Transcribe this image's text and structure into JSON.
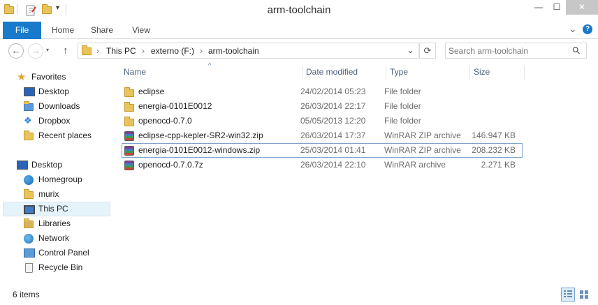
{
  "window": {
    "title": "arm-toolchain",
    "minimize_glyph": "—",
    "maximize_glyph": "☐",
    "close_glyph": "✕"
  },
  "ribbon": {
    "tabs": [
      {
        "label": "File"
      },
      {
        "label": "Home"
      },
      {
        "label": "Share"
      },
      {
        "label": "View"
      }
    ],
    "expand_glyph": "⌄",
    "help_glyph": "?"
  },
  "address": {
    "back_glyph": "←",
    "forward_glyph": "→",
    "up_glyph": "↑",
    "breadcrumbs": [
      "This PC",
      "externo (F:)",
      "arm-toolchain"
    ],
    "separator": "›",
    "dropdown_glyph": "⌄",
    "refresh_glyph": "⟳",
    "search_placeholder": "Search arm-toolchain",
    "search_glyph": "⚲"
  },
  "nav": {
    "favorites_label": "Favorites",
    "favorites": [
      {
        "label": "Desktop",
        "icon": "desktop-icon"
      },
      {
        "label": "Downloads",
        "icon": "downloads-icon"
      },
      {
        "label": "Dropbox",
        "icon": "dropbox-icon"
      },
      {
        "label": "Recent places",
        "icon": "recent-places-icon"
      }
    ],
    "desktop_label": "Desktop",
    "desktop_items": [
      {
        "label": "Homegroup",
        "icon": "homegroup-icon"
      },
      {
        "label": "murix",
        "icon": "user-folder-icon"
      },
      {
        "label": "This PC",
        "icon": "computer-icon",
        "selected": true
      },
      {
        "label": "Libraries",
        "icon": "libraries-icon"
      },
      {
        "label": "Network",
        "icon": "network-icon"
      },
      {
        "label": "Control Panel",
        "icon": "control-panel-icon"
      },
      {
        "label": "Recycle Bin",
        "icon": "recycle-bin-icon"
      }
    ]
  },
  "files": {
    "columns": {
      "name": "Name",
      "date": "Date modified",
      "type": "Type",
      "size": "Size"
    },
    "sort_glyph": "^",
    "rows": [
      {
        "name": "eclipse",
        "date": "24/02/2014 05:23",
        "type": "File folder",
        "size": "",
        "icon": "folder"
      },
      {
        "name": "energia-0101E0012",
        "date": "26/03/2014 22:17",
        "type": "File folder",
        "size": "",
        "icon": "folder"
      },
      {
        "name": "openocd-0.7.0",
        "date": "05/05/2013 12:20",
        "type": "File folder",
        "size": "",
        "icon": "folder"
      },
      {
        "name": "eclipse-cpp-kepler-SR2-win32.zip",
        "date": "26/03/2014 17:37",
        "type": "WinRAR ZIP archive",
        "size": "146.947 KB",
        "icon": "rar"
      },
      {
        "name": "energia-0101E0012-windows.zip",
        "date": "25/03/2014 01:41",
        "type": "WinRAR ZIP archive",
        "size": "208.232 KB",
        "icon": "rar",
        "selected": true
      },
      {
        "name": "openocd-0.7.0.7z",
        "date": "26/03/2014 22:10",
        "type": "WinRAR archive",
        "size": "2.271 KB",
        "icon": "rar"
      }
    ]
  },
  "status": {
    "count_text": "6 items"
  },
  "colors": {
    "accent": "#1979ca",
    "folder": "#e9c35b",
    "selection_border": "#7da2ce"
  }
}
